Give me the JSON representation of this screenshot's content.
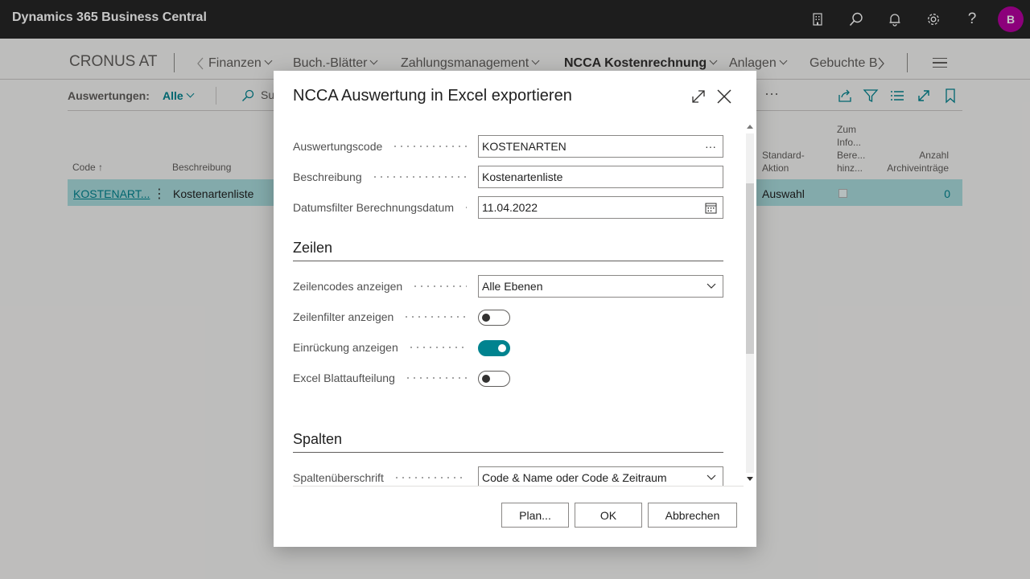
{
  "app": {
    "title": "Dynamics 365 Business Central",
    "avatar_initial": "B"
  },
  "nav": {
    "company": "CRONUS AT",
    "items": [
      "Finanzen",
      "Buch.-Blätter",
      "Zahlungsmanagement",
      "NCCA Kostenrechnung",
      "Anlagen",
      "Gebuchte B"
    ]
  },
  "actionbar": {
    "label": "Auswertungen:",
    "filter": "Alle",
    "search": "Su",
    "more": "···"
  },
  "list": {
    "columns": {
      "code": "Code ↑",
      "beschreibung": "Beschreibung",
      "standard_aktion": [
        "Standard-",
        "Aktion"
      ],
      "zum_info": [
        "Zum",
        "Info...",
        "Bere...",
        "hinz..."
      ],
      "anzahl": [
        "Anzahl",
        "Archiveinträge"
      ]
    },
    "row": {
      "code": "KOSTENART...",
      "beschreibung": "Kostenartenliste",
      "standard_aktion": "Auswahl",
      "zum_info_checked": false,
      "anzahl": "0"
    }
  },
  "dialog": {
    "title": "NCCA Auswertung in Excel exportieren",
    "fields": [
      {
        "label": "Auswertungscode",
        "value": "KOSTENARTEN",
        "suffix": "···"
      },
      {
        "label": "Beschreibung",
        "value": "Kostenartenliste"
      },
      {
        "label": "Datumsfilter Berechnungsdatum",
        "value": "11.04.2022"
      }
    ],
    "section_zeilen": "Zeilen",
    "zeilencodes": {
      "label": "Zeilencodes anzeigen",
      "value": "Alle Ebenen"
    },
    "toggles": [
      {
        "label": "Zeilenfilter anzeigen",
        "on": false
      },
      {
        "label": "Einrückung anzeigen",
        "on": true
      },
      {
        "label": "Excel Blattaufteilung",
        "on": false
      }
    ],
    "section_spalten": "Spalten",
    "spalten": {
      "label": "Spaltenüberschrift",
      "value": "Code & Name oder Code & Zeitraum"
    },
    "buttons": {
      "plan": "Plan...",
      "ok": "OK",
      "cancel": "Abbrechen"
    }
  }
}
